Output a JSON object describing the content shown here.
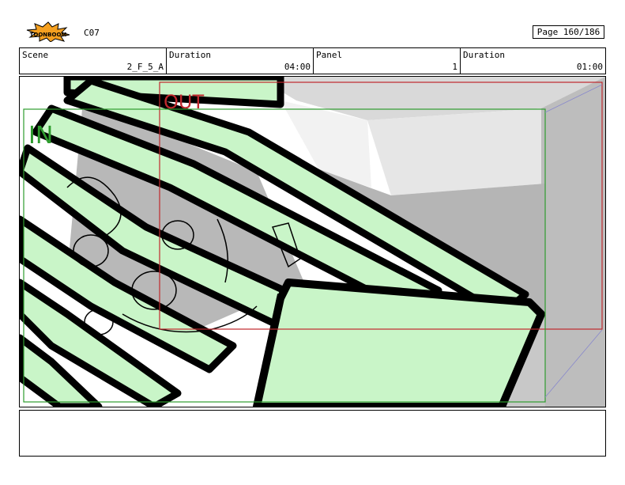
{
  "header": {
    "logo_text": "TOONBOOM",
    "episode": "C07",
    "page_label": "Page 160/186"
  },
  "info": {
    "scene_label": "Scene",
    "scene_value": "2_F_5_A",
    "duration_label": "Duration",
    "duration_value": "04:00",
    "panel_label": "Panel",
    "panel_value": "1",
    "panel_duration_label": "Duration",
    "panel_duration_value": "01:00"
  },
  "panel": {
    "in_label": "IN",
    "out_label": "OUT",
    "in_color": "#2e9c2e",
    "out_color": "#c0282d",
    "fill_color": "#c9f5c8"
  },
  "notes": {
    "text": ""
  }
}
